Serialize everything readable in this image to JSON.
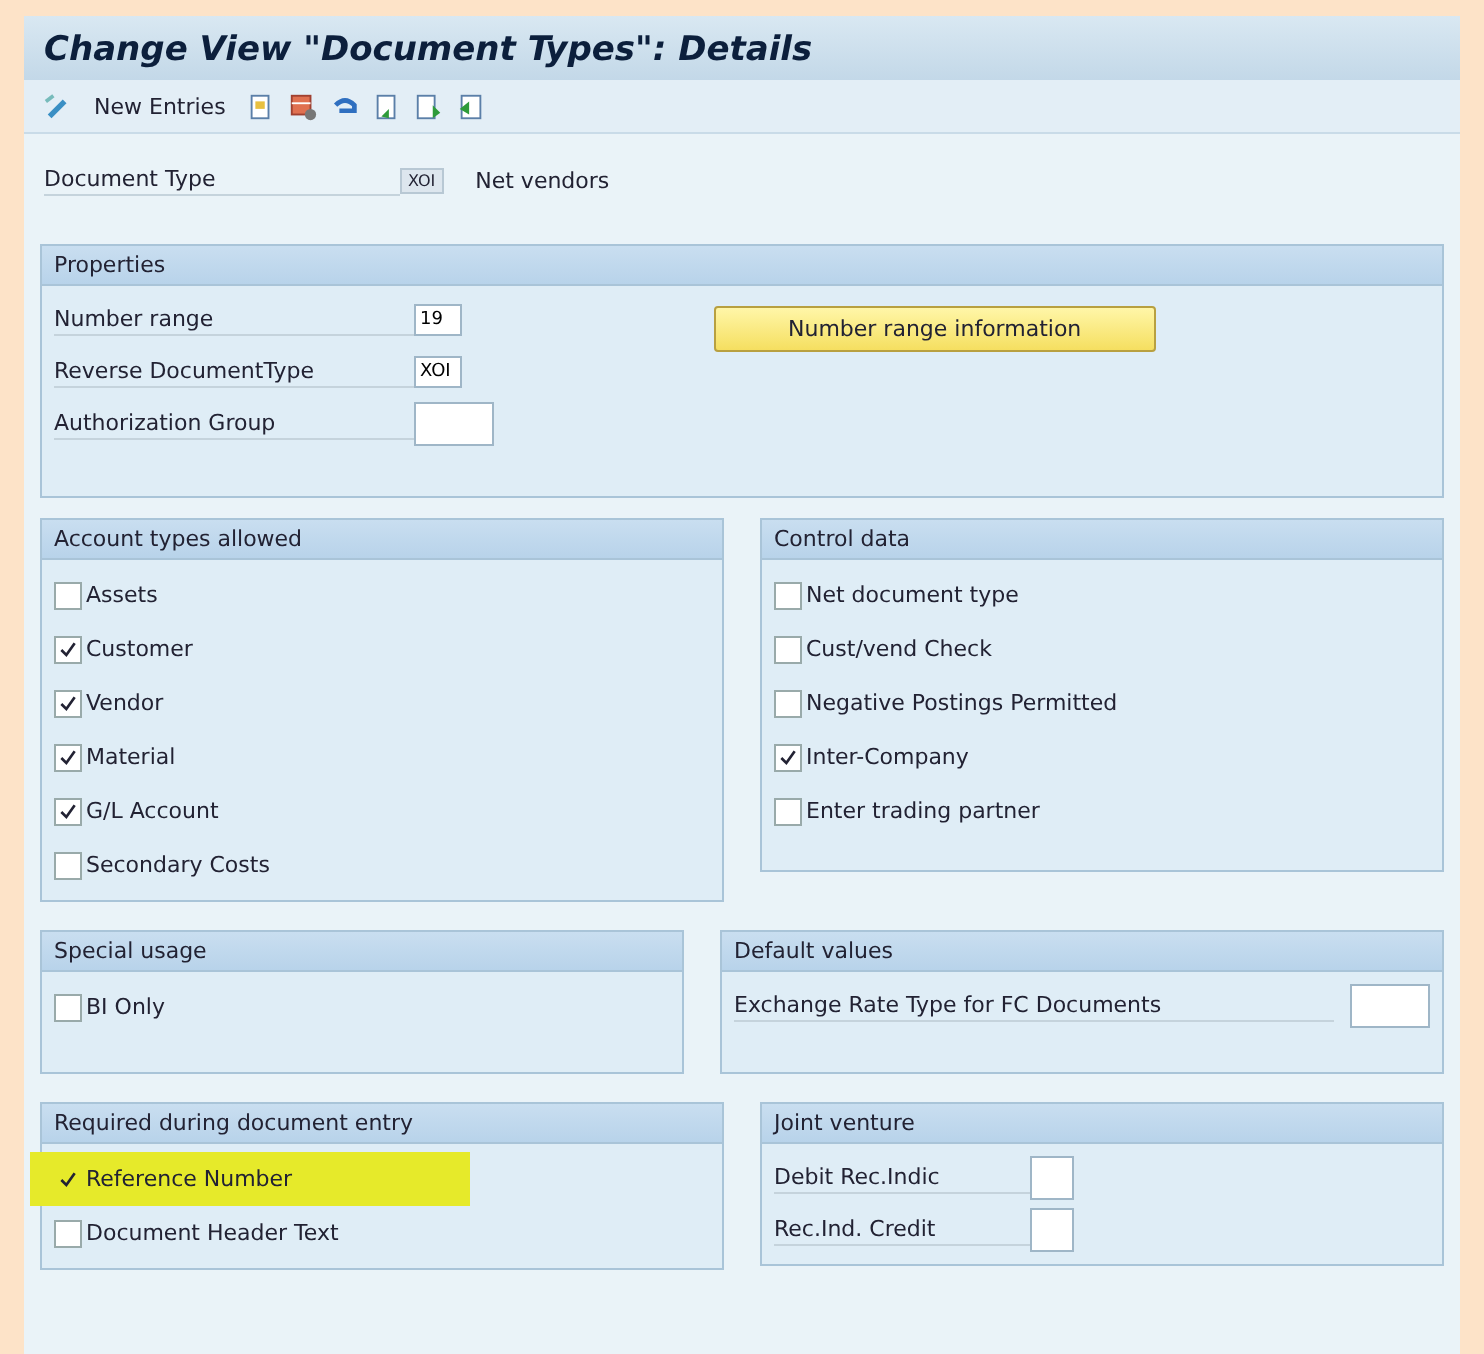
{
  "window": {
    "title": "Change View \"Document Types\": Details"
  },
  "toolbar": {
    "items": [
      {
        "kind": "edit"
      },
      {
        "kind": "text",
        "label": "New Entries"
      },
      {
        "kind": "copy"
      },
      {
        "kind": "delete"
      },
      {
        "kind": "undo"
      },
      {
        "kind": "prev"
      },
      {
        "kind": "next"
      },
      {
        "kind": "select"
      }
    ]
  },
  "document_type": {
    "label": "Document Type",
    "value": "XOI",
    "description": "Net vendors"
  },
  "properties": {
    "title": "Properties",
    "fields": [
      {
        "label": "Number range",
        "value": "19"
      },
      {
        "label": "Reverse DocumentType",
        "value": "XOI"
      },
      {
        "label": "Authorization Group"
      }
    ],
    "button": "Number range information"
  },
  "account_types": {
    "title": "Account types allowed",
    "items": [
      {
        "label": "Assets",
        "checked": false
      },
      {
        "label": "Customer",
        "checked": true
      },
      {
        "label": "Vendor",
        "checked": true
      },
      {
        "label": "Material",
        "checked": true
      },
      {
        "label": "G/L Account",
        "checked": true
      },
      {
        "label": "Secondary Costs",
        "checked": false
      }
    ]
  },
  "control_data": {
    "title": "Control data",
    "items": [
      {
        "label": "Net document type",
        "checked": false
      },
      {
        "label": "Cust/vend Check",
        "checked": false
      },
      {
        "label": "Negative Postings Permitted",
        "checked": false
      },
      {
        "label": "Inter-Company",
        "checked": true
      },
      {
        "label": "Enter trading partner",
        "checked": false
      }
    ]
  },
  "special_usage": {
    "title": "Special usage",
    "items": [
      {
        "label": "BI Only",
        "checked": false
      }
    ]
  },
  "default_values": {
    "title": "Default values",
    "fields": [
      {
        "label": "Exchange Rate Type for FC Documents"
      }
    ]
  },
  "required_entry": {
    "title": "Required during document entry",
    "items": [
      {
        "label": "Reference Number",
        "checked": true,
        "highlighted": true
      },
      {
        "label": "Document Header Text",
        "checked": false,
        "highlighted": false
      }
    ]
  },
  "joint_venture": {
    "title": "Joint venture",
    "fields": [
      {
        "label": "Debit Rec.Indic"
      },
      {
        "label": "Rec.Ind. Credit"
      }
    ]
  }
}
